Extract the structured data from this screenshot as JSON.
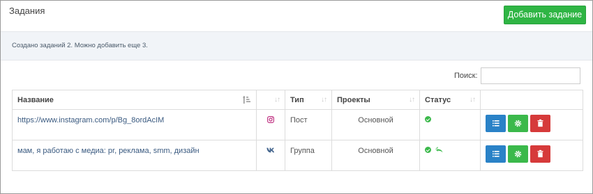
{
  "header": {
    "title": "Задания",
    "add_button": "Добавить задание"
  },
  "info": {
    "text": "Создано заданий 2. Можно добавить еще 3."
  },
  "search": {
    "label": "Поиск:",
    "value": ""
  },
  "table": {
    "columns": [
      "Название",
      "",
      "Тип",
      "Проекты",
      "Статус",
      ""
    ],
    "rows": [
      {
        "name": "https://www.instagram.com/p/Bg_8ordAcIM",
        "network_icon": "instagram-icon",
        "type": "Пост",
        "project": "Основной",
        "status": [
          "check-icon"
        ]
      },
      {
        "name": "мам, я работаю с медиа: pr, реклама, smm, дизайн",
        "network_icon": "vk-icon",
        "type": "Группа",
        "project": "Основной",
        "status": [
          "check-icon",
          "reply-icon"
        ]
      }
    ]
  },
  "colors": {
    "primary_green": "#2fb544",
    "action_blue": "#2a82c7",
    "action_green": "#3bb94b",
    "action_red": "#d63a3a",
    "instagram": "#c13584",
    "vk": "#45668e",
    "info_bg": "#f1f4f8"
  }
}
